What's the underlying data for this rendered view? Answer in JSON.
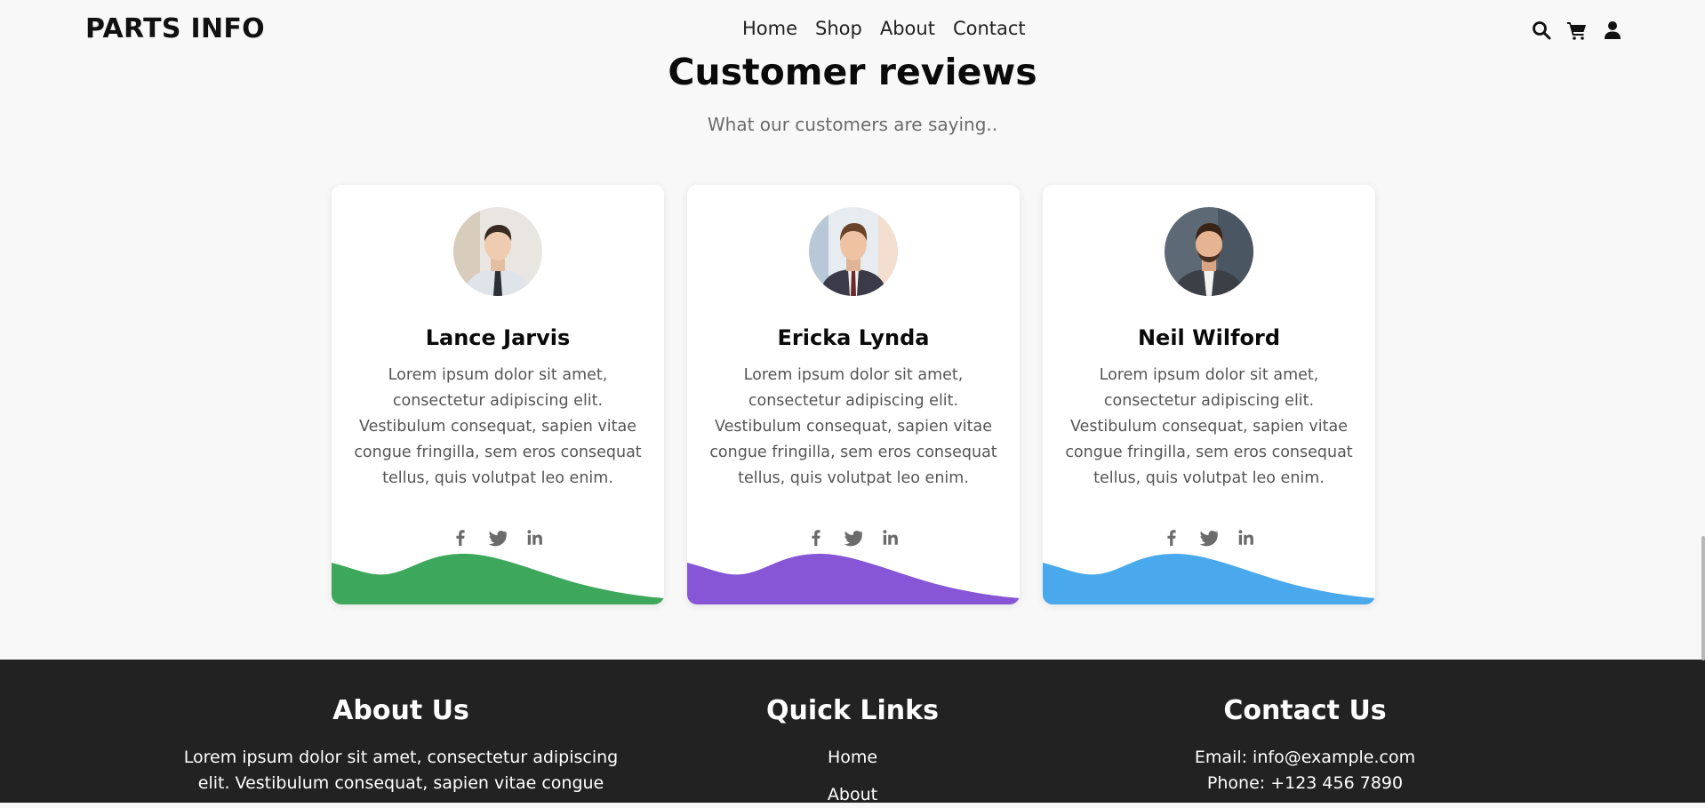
{
  "header": {
    "logo": "PARTS INFO",
    "nav": [
      "Home",
      "Shop",
      "About",
      "Contact"
    ],
    "icons": [
      "search-icon",
      "cart-icon",
      "user-icon"
    ]
  },
  "reviews": {
    "title": "Customer reviews",
    "subtitle": "What our customers are saying..",
    "cards": [
      {
        "name": "Lance Jarvis",
        "text": "Lorem ipsum dolor sit amet, consectetur adipiscing elit. Vestibulum consequat, sapien vitae congue fringilla, sem eros consequat tellus, quis volutpat leo enim.",
        "wave_color": "#3da85b"
      },
      {
        "name": "Ericka Lynda",
        "text": "Lorem ipsum dolor sit amet, consectetur adipiscing elit. Vestibulum consequat, sapien vitae congue fringilla, sem eros consequat tellus, quis volutpat leo enim.",
        "wave_color": "#8656d6"
      },
      {
        "name": "Neil Wilford",
        "text": "Lorem ipsum dolor sit amet, consectetur adipiscing elit. Vestibulum consequat, sapien vitae congue fringilla, sem eros consequat tellus, quis volutpat leo enim.",
        "wave_color": "#4aa9ec"
      }
    ],
    "social_icons": [
      "facebook-icon",
      "twitter-icon",
      "linkedin-icon"
    ]
  },
  "footer": {
    "about": {
      "title": "About Us",
      "text": "Lorem ipsum dolor sit amet, consectetur adipiscing elit. Vestibulum consequat, sapien vitae congue"
    },
    "links": {
      "title": "Quick Links",
      "items": [
        "Home",
        "About"
      ]
    },
    "contact": {
      "title": "Contact Us",
      "email": "Email: info@example.com",
      "phone": "Phone: +123 456 7890"
    }
  },
  "colors": {
    "background": "#f8f8f8",
    "footer": "#222222",
    "card": "#ffffff",
    "muted_text": "#555555",
    "social_icon": "#6b6b6b"
  }
}
